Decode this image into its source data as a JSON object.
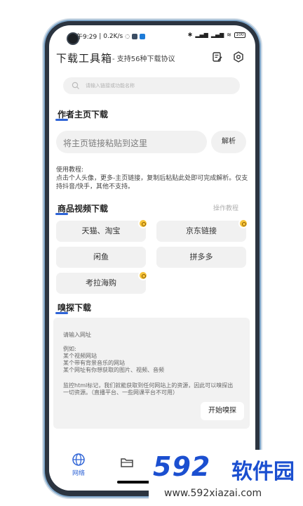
{
  "status_bar": {
    "time": "上午9:29",
    "speed": "0.2K/s",
    "battery": "100"
  },
  "header": {
    "title": "下载工具箱",
    "subtitle": "- 支持56种下载协议"
  },
  "search": {
    "placeholder": "请输入链接或功能名称"
  },
  "author_section": {
    "title": "作者主页下载",
    "input_placeholder": "将主页链接粘贴到这里",
    "parse_button": "解析",
    "tutorial_label": "使用教程:",
    "tutorial_text": "点击个人头像，更多-主页链接，复制后粘贴此处即可完成解析。仅支持抖音/快手，其他不支持。"
  },
  "product_section": {
    "title": "商品视频下载",
    "help_link": "操作教程",
    "buttons": [
      {
        "label": "天猫、淘宝",
        "badge": true
      },
      {
        "label": "京东链接",
        "badge": true
      },
      {
        "label": "闲鱼",
        "badge": false
      },
      {
        "label": "拼多多",
        "badge": false
      },
      {
        "label": "考拉海购",
        "badge": true
      }
    ]
  },
  "sniff_section": {
    "title": "嗅探下载",
    "input_placeholder": "请输入网址",
    "example_label": "例如:",
    "examples": [
      "某个视频网站",
      "某个带有背景音乐的网站",
      "某个网址有你想获取的图片、视频、音频"
    ],
    "description": "监控html标记，我们就能获取到任何网站上的资源，因此可以嗅探出一切资源。（直播平台、一些网课平台不可用）",
    "start_button": "开始嗅探"
  },
  "tabbar": {
    "tabs": [
      {
        "label": "网络",
        "icon": "globe-icon",
        "active": true
      },
      {
        "label": "",
        "icon": "folder-icon",
        "active": false
      },
      {
        "label": "",
        "icon": "radio-icon",
        "active": false
      },
      {
        "label": "",
        "icon": "download-icon",
        "active": false
      }
    ]
  },
  "watermark": {
    "logo": "592",
    "name": "软件园",
    "url": "www.592xiazai.com"
  },
  "colors": {
    "accent": "#2f64d6",
    "badge": "#f6c43a",
    "surface": "#f1f1f1"
  }
}
